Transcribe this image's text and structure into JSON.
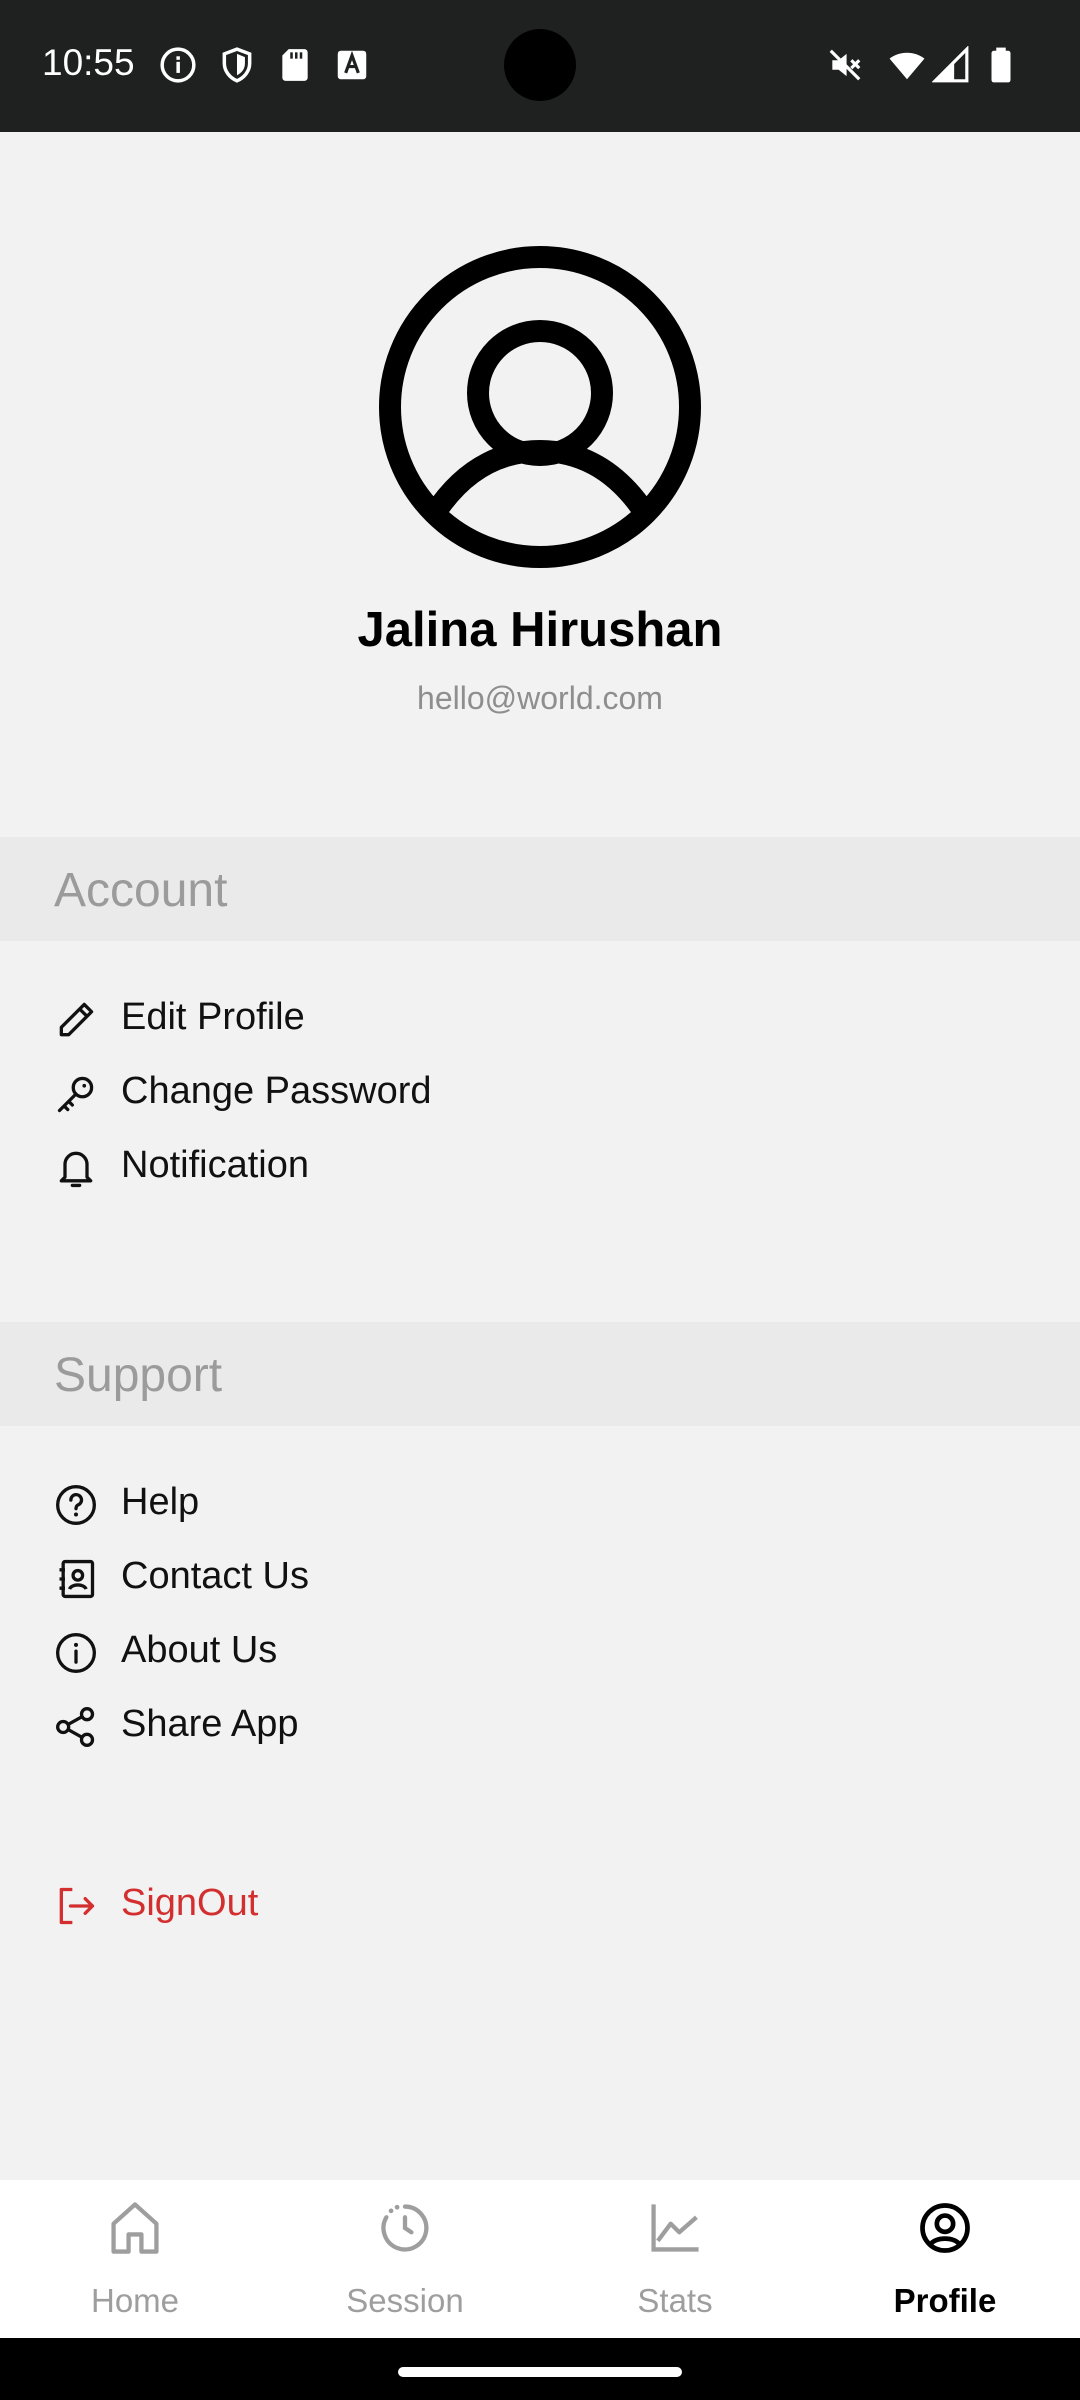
{
  "status_bar": {
    "time": "10:55",
    "left_icons": [
      "info-icon",
      "shield-icon",
      "sd-card-icon",
      "font-a-icon"
    ],
    "right_icons": [
      "vibrate-off-icon",
      "wifi-icon",
      "signal-icon",
      "battery-icon"
    ]
  },
  "profile": {
    "name": "Jalina Hirushan",
    "email": "hello@world.com"
  },
  "account": {
    "header": "Account",
    "items": [
      {
        "label": "Edit Profile",
        "icon": "pencil-icon"
      },
      {
        "label": "Change Password",
        "icon": "key-icon"
      },
      {
        "label": "Notification",
        "icon": "bell-icon"
      }
    ]
  },
  "support": {
    "header": "Support",
    "items": [
      {
        "label": "Help",
        "icon": "help-circle-icon"
      },
      {
        "label": "Contact Us",
        "icon": "contact-card-icon"
      },
      {
        "label": "About Us",
        "icon": "info-circle-icon"
      },
      {
        "label": "Share App",
        "icon": "share-icon"
      }
    ]
  },
  "signout": {
    "label": "SignOut",
    "icon": "logout-icon",
    "color": "#d32f2f"
  },
  "bottom_nav": {
    "tabs": [
      {
        "label": "Home",
        "icon": "home-icon",
        "active": false
      },
      {
        "label": "Session",
        "icon": "timer-icon",
        "active": false
      },
      {
        "label": "Stats",
        "icon": "chart-line-icon",
        "active": false
      },
      {
        "label": "Profile",
        "icon": "user-circle-icon",
        "active": true
      }
    ]
  },
  "colors": {
    "background": "#f2f2f2",
    "section_header": "#eaeaea",
    "status_bar": "#1f2121",
    "danger": "#d32f2f"
  }
}
